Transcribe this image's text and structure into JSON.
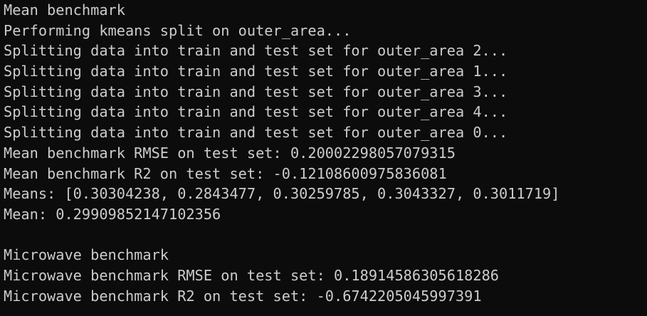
{
  "terminal": {
    "colors": {
      "background": "#0c0c0c",
      "text": "#cccccc"
    },
    "lines": [
      "Mean benchmark",
      "Performing kmeans split on outer_area...",
      "Splitting data into train and test set for outer_area 2...",
      "Splitting data into train and test set for outer_area 1...",
      "Splitting data into train and test set for outer_area 3...",
      "Splitting data into train and test set for outer_area 4...",
      "Splitting data into train and test set for outer_area 0...",
      "Mean benchmark RMSE on test set: 0.20002298057079315",
      "Mean benchmark R2 on test set: -0.12108600975836081",
      "Means: [0.30304238, 0.2843477, 0.30259785, 0.3043327, 0.3011719]",
      "Mean: 0.29909852147102356",
      "",
      "Microwave benchmark",
      "Microwave benchmark RMSE on test set: 0.18914586305618286",
      "Microwave benchmark R2 on test set: -0.6742205045997391"
    ]
  }
}
